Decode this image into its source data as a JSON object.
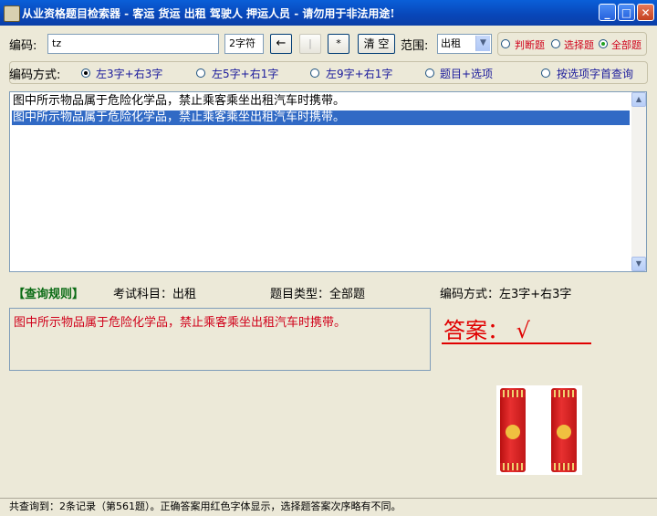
{
  "window": {
    "title": "从业资格题目检索器 - 客运 货运 出租 驾驶人 押运人员 - 请勿用于非法用途!",
    "minimize": "_",
    "maximize": "□",
    "close": "✕"
  },
  "toolbar": {
    "code_label": "编码:",
    "code_value": "tz",
    "char_count": "2字符",
    "back_label": "←",
    "blank_label": "|",
    "wildcard_label": "*",
    "clear_label": "清 空",
    "range_label": "范围:",
    "range_value": "出租",
    "type_options": [
      "判断题",
      "选择题",
      "全部题"
    ],
    "type_selected": "全部题"
  },
  "encoding": {
    "label": "编码方式:",
    "options": [
      "左3字+右3字",
      "左5字+右1字",
      "左9字+右1字",
      "题目+选项",
      "按选项字首查询"
    ],
    "selected": "左3字+右3字"
  },
  "results_list": {
    "items": [
      "图中所示物品属于危险化学品，禁止乘客乘坐出租汽车时携带。",
      "图中所示物品属于危险化学品，禁止乘客乘坐出租汽车时携带。"
    ],
    "selected_index": 1
  },
  "query_info": {
    "rules_label": "【查询规则】",
    "subject": "考试科目：出租",
    "question_type": "题目类型：全部题",
    "encoding": "编码方式：左3字+右3字"
  },
  "detail": {
    "question": "图中所示物品属于危险化学品，禁止乘客乘坐出租汽车时携带。",
    "answer": "答案：  √"
  },
  "status": "共查询到：2条记录（第561题）。正确答案用红色字体显示，选择题答案次序略有不同。",
  "colors": {
    "answer": "#e00000",
    "question_text": "#d0021b",
    "selection": "#316ac5",
    "titlebar": "#0a5fd8"
  }
}
